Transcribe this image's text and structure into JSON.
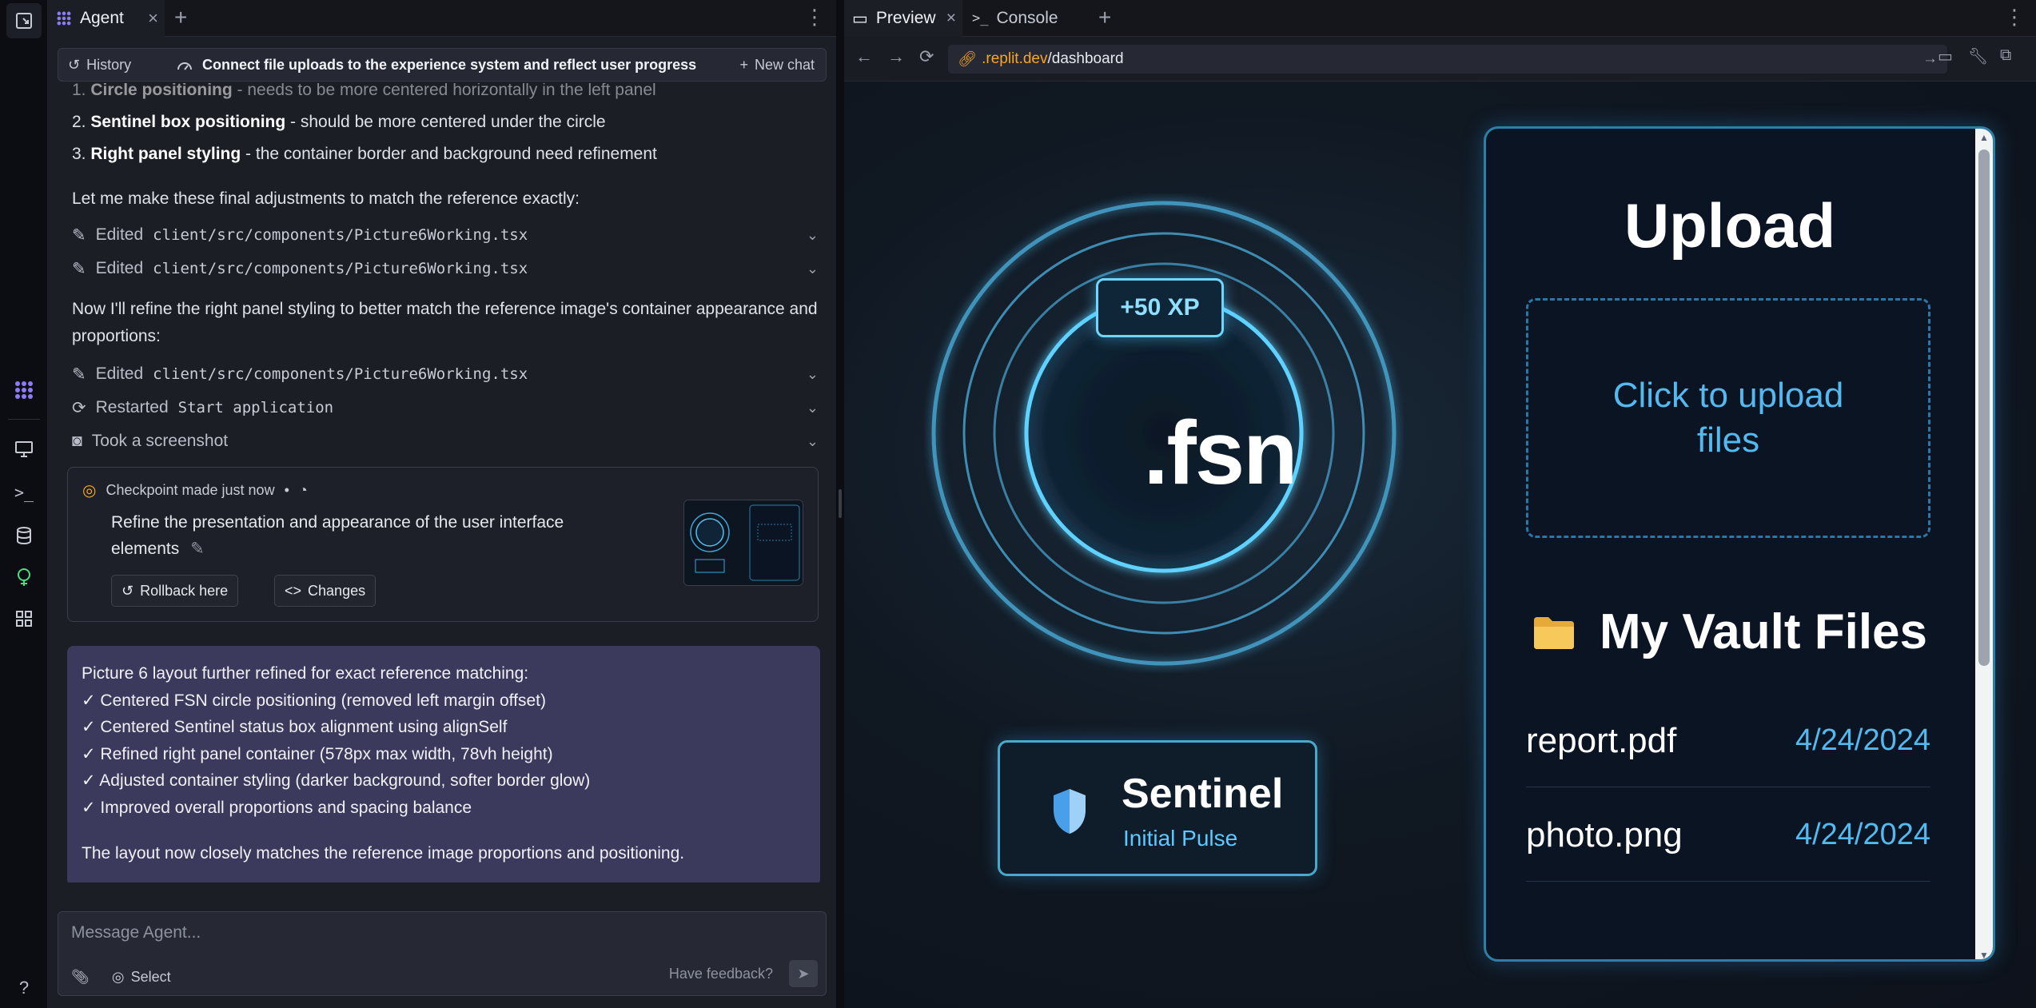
{
  "agent_tab": {
    "label": "Agent"
  },
  "chatbar": {
    "history": "History",
    "title": "Connect file uploads to the experience system and reflect user progress",
    "new_chat": "New chat"
  },
  "messages": {
    "item1_bold": "Circle positioning",
    "item1_rest": " - needs to be more centered horizontally in the left panel",
    "item2_bold": "Sentinel box positioning",
    "item2_rest": " - should be more centered under the circle",
    "item3_bold": "Right panel styling",
    "item3_rest": " - the container border and background need refinement",
    "p1": "Let me make these final adjustments to match the reference exactly:",
    "p2": "Now I'll refine the right panel styling to better match the reference image's container appearance and proportions:"
  },
  "actions": [
    {
      "verb": "Edited",
      "target": "client/src/components/Picture6Working.tsx"
    },
    {
      "verb": "Edited",
      "target": "client/src/components/Picture6Working.tsx"
    },
    {
      "verb": "Edited",
      "target": "client/src/components/Picture6Working.tsx"
    },
    {
      "verb": "Restarted",
      "target": "Start application"
    },
    {
      "verb": "Took a screenshot",
      "target": ""
    }
  ],
  "checkpoint": {
    "title": "Checkpoint made just now",
    "sep": "•",
    "description": "Refine the presentation and appearance of the user interface elements",
    "rollback": "Rollback here",
    "changes": "Changes"
  },
  "summary": {
    "heading": "Picture 6 layout further refined for exact reference matching:",
    "items": [
      "✓ Centered FSN circle positioning (removed left margin offset)",
      "✓ Centered Sentinel status box alignment using alignSelf",
      "✓ Refined right panel container (578px max width, 78vh height)",
      "✓ Adjusted container styling (darker background, softer border glow)",
      "✓ Improved overall proportions and spacing balance"
    ],
    "footer": "The layout now closely matches the reference image proportions and positioning."
  },
  "composer": {
    "placeholder": "Message Agent...",
    "select": "Select",
    "feedback": "Have feedback?"
  },
  "preview_tabs": {
    "preview": "Preview",
    "console": "Console"
  },
  "url": {
    "host": ".replit.dev",
    "path": "/dashboard"
  },
  "app": {
    "xp": "+50 XP",
    "logo": ".fsn",
    "sentinel_name": "Sentinel",
    "sentinel_status": "Initial Pulse",
    "upload_title": "Upload",
    "dropzone": "Click to upload files",
    "vault_title": "My Vault Files",
    "files": [
      {
        "name": "report.pdf",
        "date": "4/24/2024"
      },
      {
        "name": "photo.png",
        "date": "4/24/2024"
      }
    ]
  },
  "colors": {
    "accent": "#54b9ef",
    "summary_bg": "#3c3a5c",
    "ring": "#5fc9f5"
  }
}
